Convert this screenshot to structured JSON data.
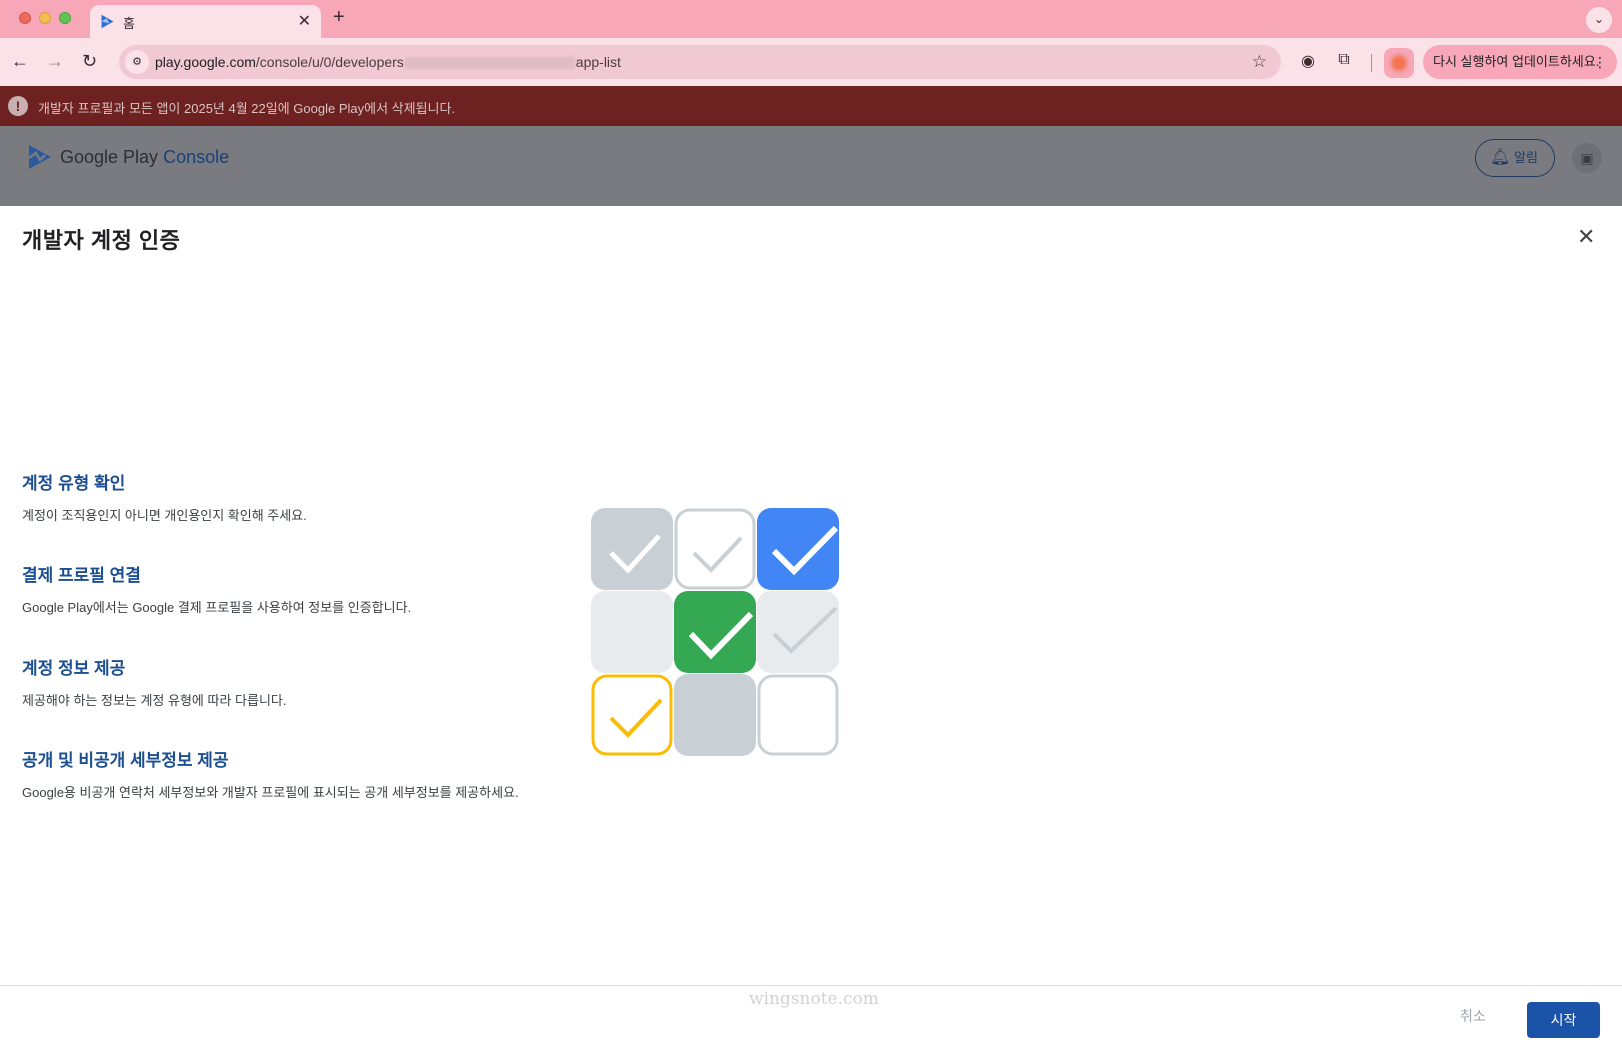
{
  "browser": {
    "tab": {
      "title": "홈"
    },
    "address_bar": {
      "url_host": "play.google.com",
      "url_path_start": "/console/u/0/developers",
      "url_path_end": "app-list"
    },
    "update_button": {
      "label": "다시 실행하여 업데이트하세요."
    }
  },
  "page": {
    "alert": {
      "text": "개발자 프로필과 모든 앱이 2025년 4월 22일에 Google Play에서 삭제됩니다."
    },
    "header": {
      "logo_text": "Google Play",
      "logo_text_console": "Console",
      "notifications_label": "알림"
    }
  },
  "dialog": {
    "title": "개발자 계정 인증",
    "steps": [
      {
        "title": "계정 유형 확인",
        "description": "계정이 조직용인지 아니면 개인용인지 확인해 주세요."
      },
      {
        "title": "결제 프로필 연결",
        "description": "Google Play에서는 Google 결제 프로필을 사용하여 정보를 인증합니다."
      },
      {
        "title": "계정 정보 제공",
        "description": "제공해야 하는 정보는 계정 유형에 따라 다릅니다."
      },
      {
        "title": "공개 및 비공개 세부정보 제공",
        "description": "Google용 비공개 연락처 세부정보와 개발자 프로필에 표시되는 공개 세부정보를 제공하세요."
      }
    ],
    "footer": {
      "watermark": "wingsnote.com",
      "cancel_label": "취소",
      "start_label": "시작"
    }
  },
  "colors": {
    "tab_strip": "#f7a7b7",
    "alert_bar": "#6d2121",
    "step_title": "#1b4f91",
    "primary_button": "#1b53a8",
    "check_blue": "#4285f4",
    "check_green": "#34a853",
    "check_yellow": "#fbbc04",
    "check_gray": "#c8d0d6"
  }
}
